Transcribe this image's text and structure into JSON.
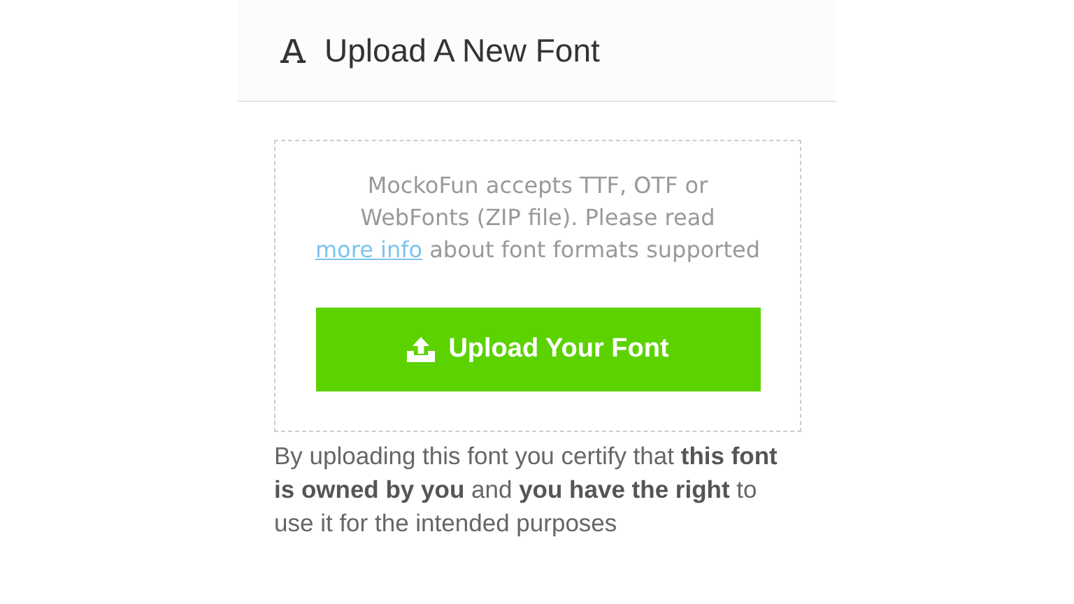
{
  "header": {
    "title": "Upload A New Font"
  },
  "dropzone": {
    "text_before": "MockoFun accepts TTF, OTF or WebFonts (ZIP file). Please read",
    "link": "more info",
    "text_after": "about font formats supported"
  },
  "upload_button": {
    "label": "Upload Your Font"
  },
  "notice": "By uploading this font you certify that **this font is owned by you** and **you have the right** to use it for the intended purposes"
}
